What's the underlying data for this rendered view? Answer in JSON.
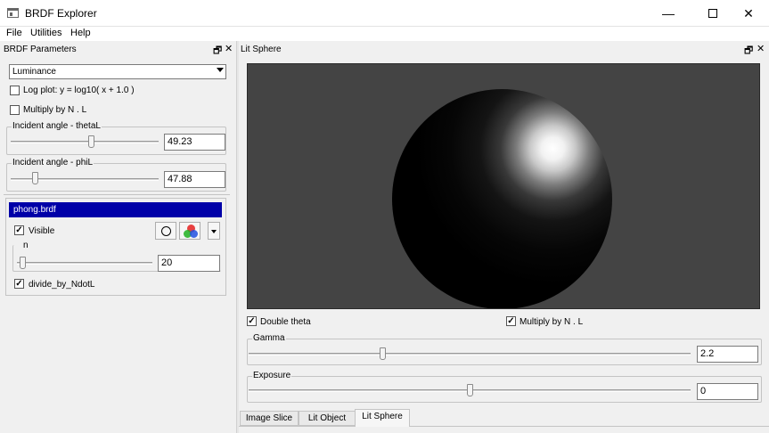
{
  "window": {
    "title": "BRDF Explorer",
    "min": "—",
    "close": "✕"
  },
  "menu": [
    "File",
    "Utilities",
    "Help"
  ],
  "left_panel": {
    "title": "BRDF Parameters",
    "float": "🗗",
    "close": "✕",
    "mode_select": "Luminance",
    "log_plot_label": "Log plot:  y = log10( x + 1.0 )",
    "log_plot_checked": false,
    "multiply_label": "Multiply by N . L",
    "multiply_checked": false,
    "theta_group": "Incident angle - thetaL",
    "theta_value": "49.23",
    "theta_position": 0.55,
    "phi_group": "Incident angle - phiL",
    "phi_value": "47.88",
    "phi_position": 0.15,
    "brdf": {
      "name": "phong.brdf",
      "visible_label": "Visible",
      "visible_checked": true,
      "n_label": "n",
      "n_value": "20",
      "n_position": 0.02,
      "divide_label": "divide_by_NdotL",
      "divide_checked": true
    }
  },
  "right_panel": {
    "title": "Lit Sphere",
    "float": "🗗",
    "close": "✕",
    "double_theta_label": "Double theta",
    "double_theta_checked": true,
    "multiply_label": "Multiply by N . L",
    "multiply_checked": true,
    "gamma_label": "Gamma",
    "gamma_value": "2.2",
    "gamma_position": 0.3,
    "exposure_label": "Exposure",
    "exposure_value": "0",
    "exposure_position": 0.5
  },
  "tabs": [
    "Image Slice",
    "Lit Object",
    "Lit Sphere"
  ],
  "active_tab": "Lit Sphere",
  "check_glyph": "✓"
}
